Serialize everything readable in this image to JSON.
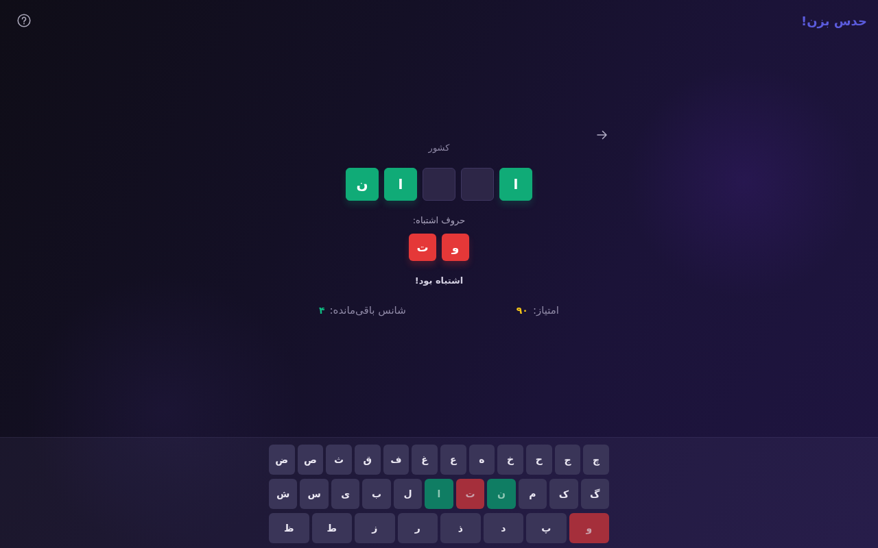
{
  "header": {
    "title": "حدس بزن!"
  },
  "game": {
    "category": "کشور",
    "slots": [
      {
        "letter": "ا",
        "revealed": true
      },
      {
        "revealed": false
      },
      {
        "revealed": false
      },
      {
        "letter": "ا",
        "revealed": true
      },
      {
        "letter": "ن",
        "revealed": true
      }
    ],
    "wrong_label": "حروف اشتباه:",
    "wrong_letters": [
      "و",
      "ت"
    ],
    "message": "اشتباه بود!",
    "stats": [
      {
        "label": "امتیاز:",
        "value": "۹۰",
        "color": "#f5c518"
      },
      {
        "label": "شانس باقی‌مانده:",
        "value": "۴",
        "color": "#10b981"
      }
    ]
  },
  "keyboard": {
    "rows": [
      {
        "keys": [
          {
            "key": "چ",
            "correct": false,
            "wrong": false
          },
          {
            "key": "ج",
            "correct": false,
            "wrong": false
          },
          {
            "key": "ح",
            "correct": false,
            "wrong": false
          },
          {
            "key": "خ",
            "correct": false,
            "wrong": false
          },
          {
            "key": "ه",
            "correct": false,
            "wrong": false
          },
          {
            "key": "ع",
            "correct": false,
            "wrong": false
          },
          {
            "key": "غ",
            "correct": false,
            "wrong": false
          },
          {
            "key": "ف",
            "correct": false,
            "wrong": false
          },
          {
            "key": "ق",
            "correct": false,
            "wrong": false
          },
          {
            "key": "ث",
            "correct": false,
            "wrong": false
          },
          {
            "key": "ص",
            "correct": false,
            "wrong": false
          },
          {
            "key": "ض",
            "correct": false,
            "wrong": false
          }
        ]
      },
      {
        "keys": [
          {
            "key": "گ",
            "correct": false,
            "wrong": false
          },
          {
            "key": "ک",
            "correct": false,
            "wrong": false
          },
          {
            "key": "م",
            "correct": false,
            "wrong": false
          },
          {
            "key": "ن",
            "correct": true,
            "wrong": false
          },
          {
            "key": "ت",
            "correct": false,
            "wrong": true
          },
          {
            "key": "ا",
            "correct": true,
            "wrong": false
          },
          {
            "key": "ل",
            "correct": false,
            "wrong": false
          },
          {
            "key": "ب",
            "correct": false,
            "wrong": false
          },
          {
            "key": "ی",
            "correct": false,
            "wrong": false
          },
          {
            "key": "س",
            "correct": false,
            "wrong": false
          },
          {
            "key": "ش",
            "correct": false,
            "wrong": false
          }
        ]
      },
      {
        "keys": [
          {
            "key": "و",
            "correct": false,
            "wrong": true
          },
          {
            "key": "پ",
            "correct": false,
            "wrong": false
          },
          {
            "key": "د",
            "correct": false,
            "wrong": false
          },
          {
            "key": "ذ",
            "correct": false,
            "wrong": false
          },
          {
            "key": "ر",
            "correct": false,
            "wrong": false
          },
          {
            "key": "ز",
            "correct": false,
            "wrong": false
          },
          {
            "key": "ط",
            "correct": false,
            "wrong": false
          },
          {
            "key": "ظ",
            "correct": false,
            "wrong": false
          }
        ]
      }
    ]
  }
}
